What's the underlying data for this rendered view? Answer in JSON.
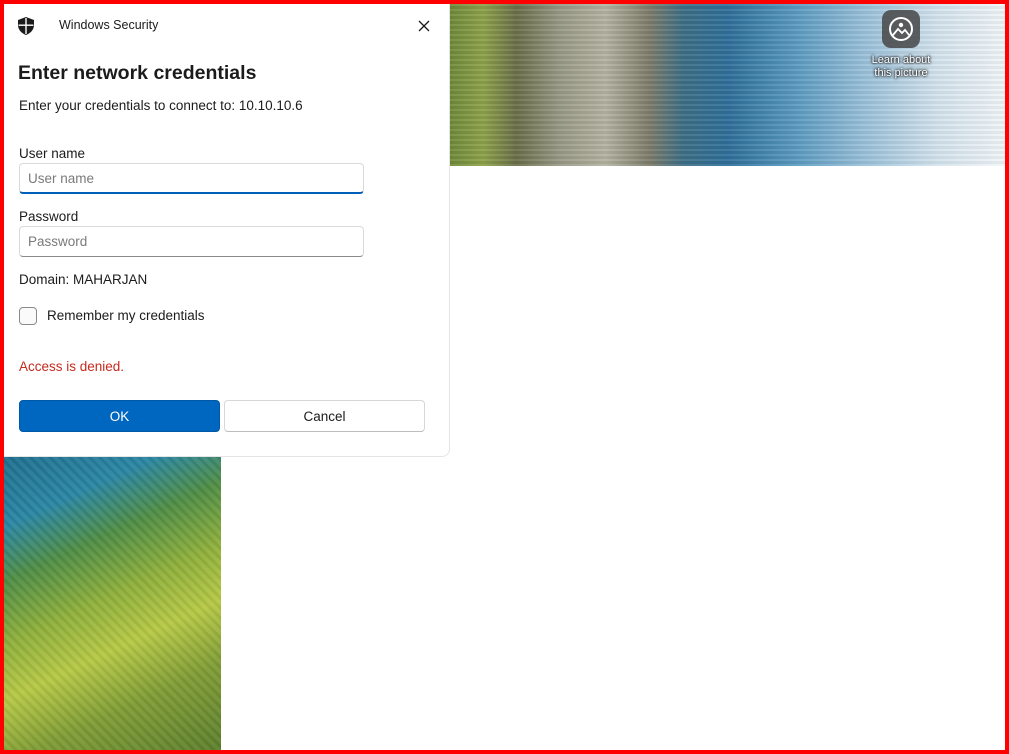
{
  "dialog": {
    "app_title": "Windows Security",
    "heading": "Enter network credentials",
    "subtitle": "Enter your credentials to connect to: 10.10.10.6",
    "username": {
      "label": "User name",
      "placeholder": "User name",
      "value": ""
    },
    "password": {
      "label": "Password",
      "placeholder": "Password",
      "value": ""
    },
    "domain": "Domain: MAHARJAN",
    "remember_label": "Remember my credentials",
    "remember_checked": false,
    "error": "Access is denied.",
    "ok_label": "OK",
    "cancel_label": "Cancel",
    "icons": {
      "app": "shield-icon",
      "close": "close-icon"
    }
  },
  "desktop": {
    "learn_label": "Learn about this picture",
    "learn_icon": "camera-info-icon"
  },
  "colors": {
    "accent": "#0067c0",
    "error": "#c42b1c",
    "frame_border": "#ff0000"
  }
}
